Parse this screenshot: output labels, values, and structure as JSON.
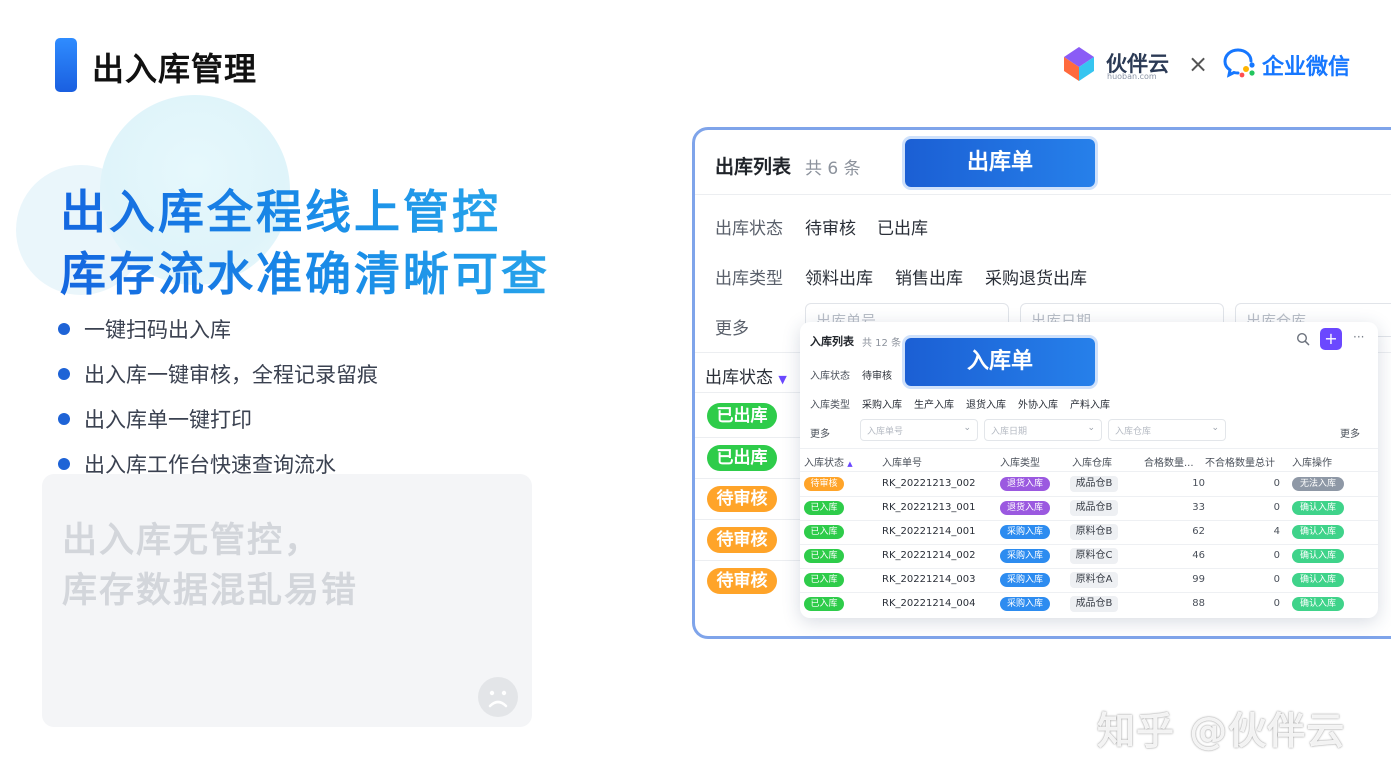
{
  "header": {
    "title": "出入库管理",
    "brand_name": "伙伴云",
    "brand_domain": "huoban.com",
    "times": "×",
    "partner_name": "企业微信"
  },
  "hero": {
    "line1": "出入库全程线上管控",
    "line2": "库存流水准确清晰可查",
    "bullets": [
      "一键扫码出入库",
      "出入库一键审核，全程记录留痕",
      "出入库单一键打印",
      "出入库工作台快速查询流水"
    ]
  },
  "contrast_card": {
    "line1": "出入库无管控，",
    "line2": "库存数据混乱易错"
  },
  "out_panel": {
    "title": "出库列表",
    "count": "共 6 条",
    "badge": "出库单",
    "status_label": "出库状态",
    "status_options": [
      "待审核",
      "已出库"
    ],
    "type_label": "出库类型",
    "type_options": [
      "领料出库",
      "销售出库",
      "采购退货出库"
    ],
    "more_label": "更多",
    "filter_placeholders": [
      "出库单号",
      "出库日期",
      "出库仓库"
    ],
    "column_status": "出库状态",
    "rows": [
      "已出库",
      "已出库",
      "待审核",
      "待审核",
      "待审核"
    ]
  },
  "in_panel": {
    "title": "入库列表",
    "count": "共 12 条",
    "badge": "入库单",
    "more_dots": "···",
    "plus": "+",
    "status_label": "入库状态",
    "status_options": [
      "待审核"
    ],
    "type_label": "入库类型",
    "type_options": [
      "采购入库",
      "生产入库",
      "退货入库",
      "外协入库",
      "产料入库"
    ],
    "more_label": "更多",
    "more_right": "更多",
    "filter_placeholders": [
      "入库单号",
      "入库日期",
      "入库仓库"
    ],
    "columns": [
      "入库状态",
      "入库单号",
      "入库类型",
      "入库仓库",
      "合格数量...",
      "不合格数量总计",
      "入库操作"
    ],
    "rows": [
      {
        "status": "待审核",
        "no": "RK_20221213_002",
        "type": "退货入库",
        "wh": "成品仓B",
        "qty": "10",
        "bad": "0",
        "op": "无法入库"
      },
      {
        "status": "已入库",
        "no": "RK_20221213_001",
        "type": "退货入库",
        "wh": "成品仓B",
        "qty": "33",
        "bad": "0",
        "op": "确认入库"
      },
      {
        "status": "已入库",
        "no": "RK_20221214_001",
        "type": "采购入库",
        "wh": "原料仓B",
        "qty": "62",
        "bad": "4",
        "op": "确认入库"
      },
      {
        "status": "已入库",
        "no": "RK_20221214_002",
        "type": "采购入库",
        "wh": "原料仓C",
        "qty": "46",
        "bad": "0",
        "op": "确认入库"
      },
      {
        "status": "已入库",
        "no": "RK_20221214_003",
        "type": "采购入库",
        "wh": "原料仓A",
        "qty": "99",
        "bad": "0",
        "op": "确认入库"
      },
      {
        "status": "已入库",
        "no": "RK_20221214_004",
        "type": "采购入库",
        "wh": "成品仓B",
        "qty": "88",
        "bad": "0",
        "op": "确认入库"
      }
    ]
  },
  "watermark": "知乎 @伙伴云",
  "colors": {
    "accent_blue": "#1e63d6",
    "status_green": "#2ecc4a",
    "status_orange": "#ffa429",
    "brand_purple": "#6b48ff"
  }
}
